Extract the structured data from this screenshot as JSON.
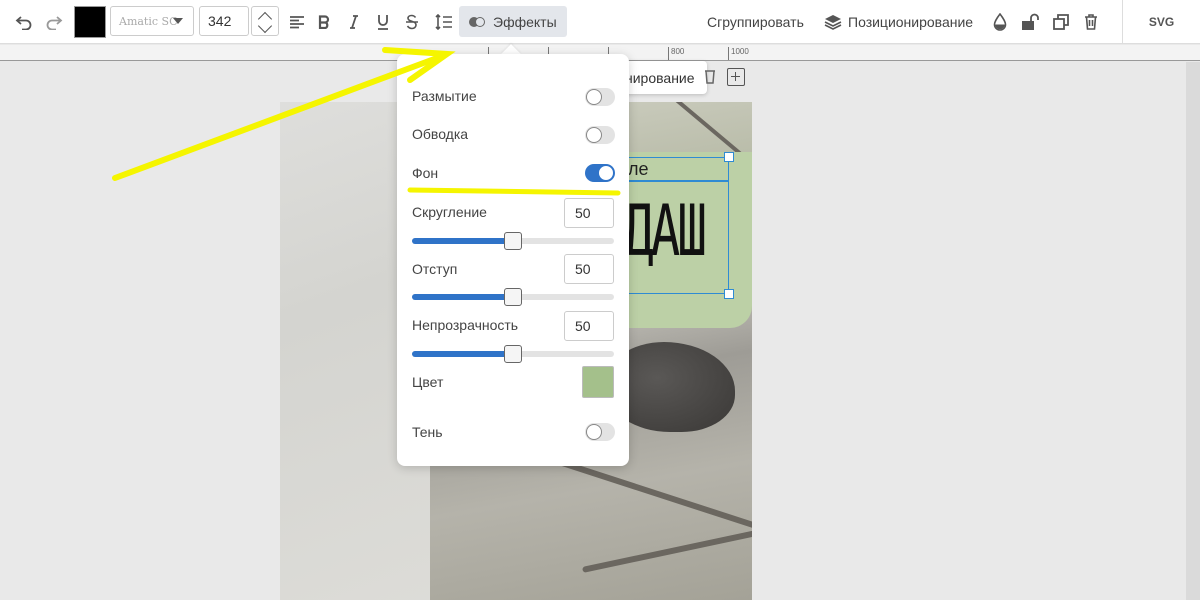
{
  "toolbar": {
    "text_color": "#000000",
    "font_name": "Amatic SC",
    "font_size": "342",
    "effects_label": "Эффекты",
    "group_label": "Сгруппировать",
    "positioning_label": "Позиционирование",
    "export_label": "SVG"
  },
  "ruler": {
    "ticks": [
      "800",
      "1000"
    ]
  },
  "canvas": {
    "floating_toolbar_label": "нирование",
    "text_small": "ле",
    "text_big": "ДАШ",
    "background_color": "#bcd0a6"
  },
  "effects_panel": {
    "blur": {
      "label": "Размытие",
      "enabled": false
    },
    "stroke": {
      "label": "Обводка",
      "enabled": false
    },
    "background": {
      "label": "Фон",
      "enabled": true
    },
    "rounding": {
      "label": "Скругление",
      "value": "50",
      "slider_percent": 50
    },
    "padding": {
      "label": "Отступ",
      "value": "50",
      "slider_percent": 50
    },
    "opacity": {
      "label": "Непрозрачность",
      "value": "50",
      "slider_percent": 50
    },
    "color": {
      "label": "Цвет",
      "value": "#a4c08b"
    },
    "shadow": {
      "label": "Тень",
      "enabled": false
    }
  },
  "annotation": {
    "color": "#f5f500"
  }
}
